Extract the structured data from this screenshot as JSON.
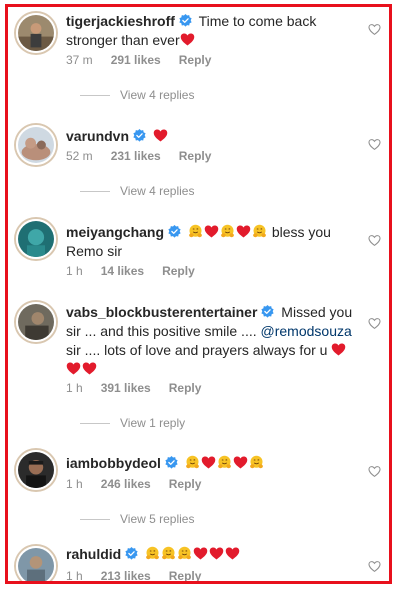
{
  "comments": [
    {
      "username": "tigerjackieshroff",
      "verified": true,
      "text": "Time to come back stronger than ever",
      "emojis": [
        "red-heart"
      ],
      "time": "37 m",
      "likes": "291 likes",
      "reply_label": "Reply",
      "view_replies": "View 4 replies"
    },
    {
      "username": "varundvn",
      "verified": true,
      "emojis": [
        "red-heart"
      ],
      "time": "52 m",
      "likes": "231 likes",
      "reply_label": "Reply",
      "view_replies": "View 4 replies"
    },
    {
      "username": "meiyangchang",
      "verified": true,
      "emojis": [
        "hugging-face",
        "red-heart",
        "hugging-face",
        "red-heart",
        "hugging-face"
      ],
      "text": "bless you Remo sir",
      "time": "1 h",
      "likes": "14 likes",
      "reply_label": "Reply"
    },
    {
      "username": "vabs_blockbusterentertainer",
      "verified": true,
      "text": "Missed you sir ... and this positive smile ....",
      "mention": "@remodsouza",
      "text_after": "sir .... lots of love and prayers always for u",
      "emojis": [
        "red-heart",
        "red-heart",
        "red-heart"
      ],
      "time": "1 h",
      "likes": "391 likes",
      "reply_label": "Reply",
      "view_replies": "View 1 reply"
    },
    {
      "username": "iambobbydeol",
      "verified": true,
      "emojis": [
        "hugging-face",
        "red-heart",
        "hugging-face",
        "red-heart",
        "hugging-face"
      ],
      "time": "1 h",
      "likes": "246 likes",
      "reply_label": "Reply",
      "view_replies": "View 5 replies"
    },
    {
      "username": "rahuldid",
      "verified": true,
      "emojis": [
        "hugging-face",
        "hugging-face",
        "hugging-face",
        "red-heart",
        "red-heart",
        "red-heart"
      ],
      "time": "1 h",
      "likes": "213 likes",
      "reply_label": "Reply"
    }
  ],
  "colors": {
    "frame": "#e8101c",
    "verified": "#3897f0",
    "heart": "#e0245e",
    "meta": "#8e8e8e",
    "mention": "#00376b"
  }
}
